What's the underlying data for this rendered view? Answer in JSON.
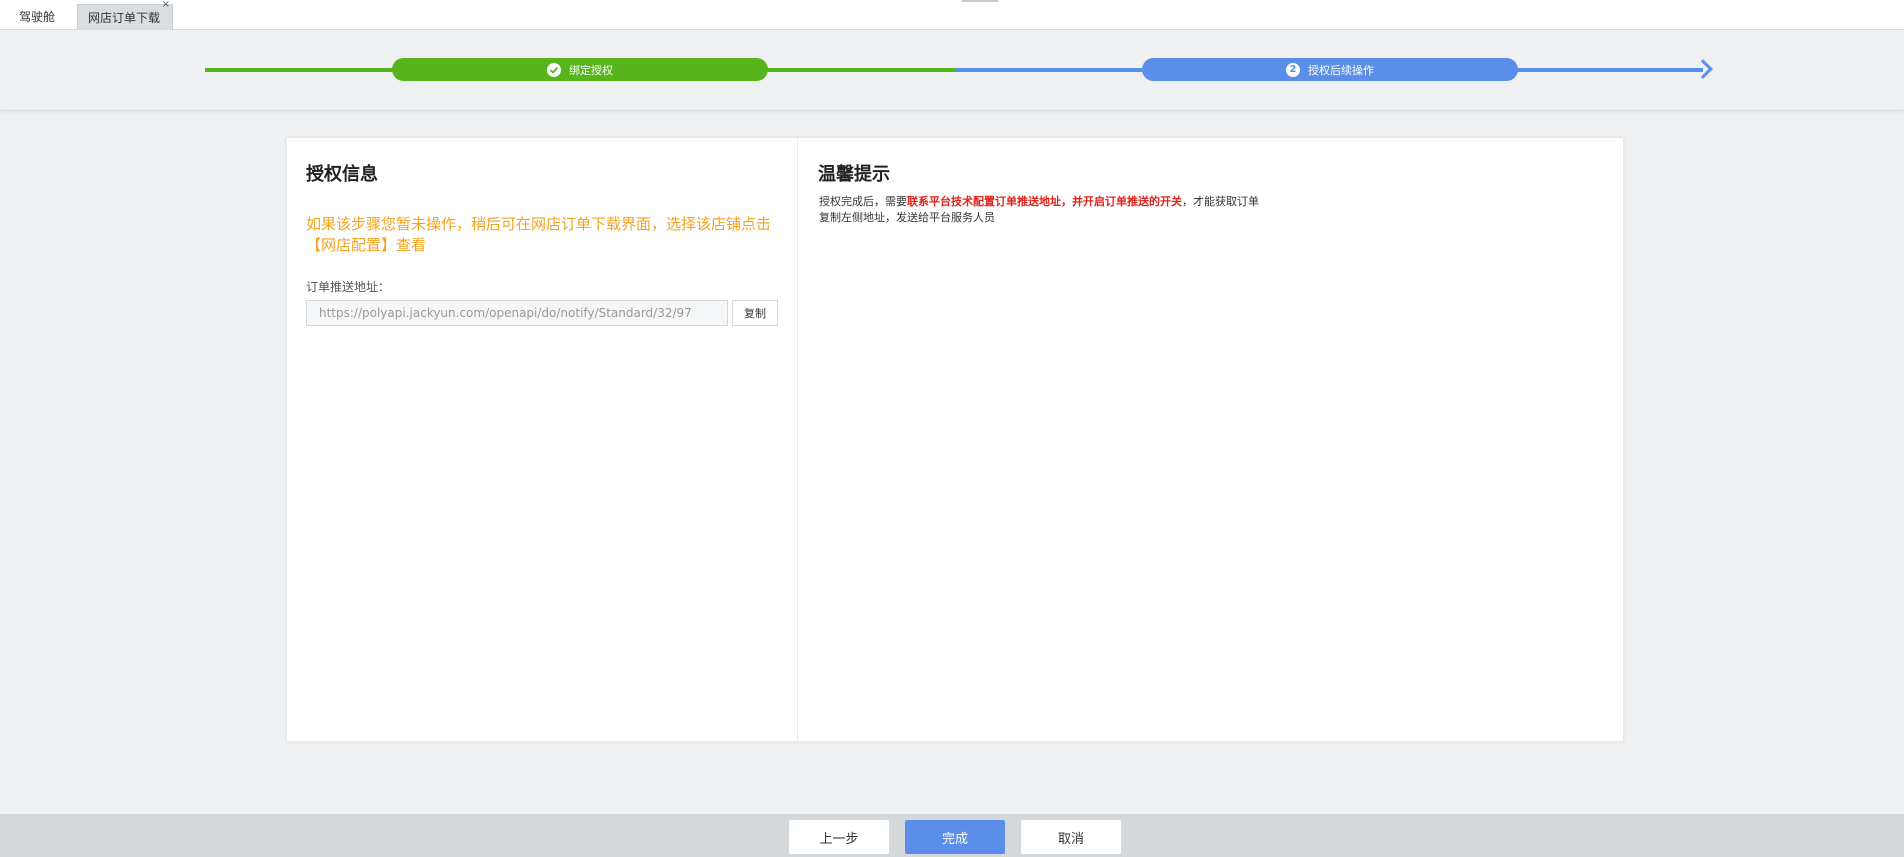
{
  "tabs": {
    "home_label": "驾驶舱",
    "active_label": "网店订单下载",
    "close_glyph": "×"
  },
  "steps": {
    "step1_label": "绑定授权",
    "step2_number": "2",
    "step2_label": "授权后续操作",
    "completed_color": "#58b41d",
    "current_color": "#5b8ee8"
  },
  "auth_info": {
    "title": "授权信息",
    "warning": "如果该步骤您暂未操作，稍后可在网店订单下载界面，选择该店铺点击【网店配置】查看",
    "field_label": "订单推送地址：",
    "url_value": "https://polyapi.jackyun.com/openapi/do/notify/Standard/32/97",
    "copy_label": "复制"
  },
  "tips": {
    "title": "温馨提示",
    "text_part1": "授权完成后，需要",
    "text_red1": "联系平台技术配置订单推送地址",
    "text_sep": "，",
    "text_red2": "并开启订单推送的开关",
    "text_part2": "，才能获取订单",
    "text_line2": "复制左侧地址，发送给平台服务人员"
  },
  "footer": {
    "prev_label": "上一步",
    "done_label": "完成",
    "cancel_label": "取消"
  }
}
